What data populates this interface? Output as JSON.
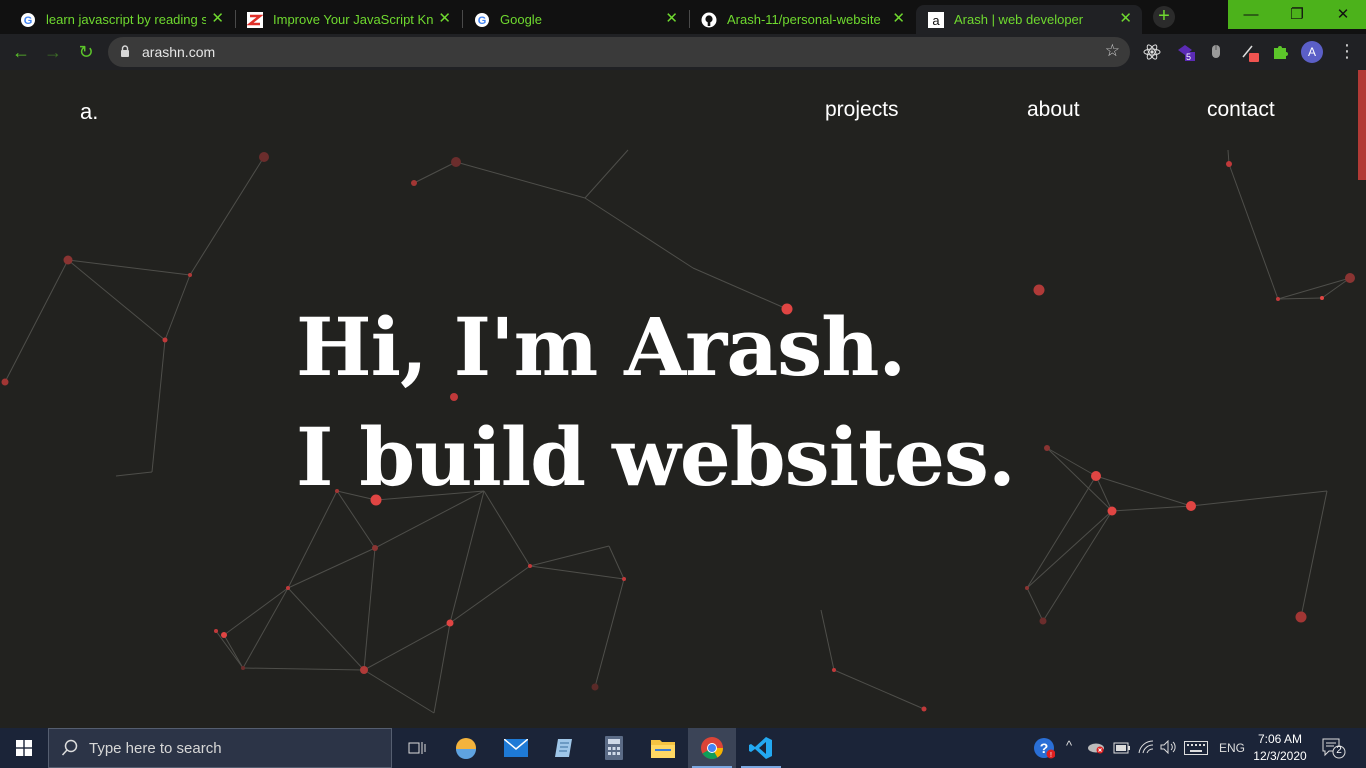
{
  "browser": {
    "tabs": [
      {
        "title": "learn javascript by reading sou",
        "icon": "google-icon"
      },
      {
        "title": "Improve Your JavaScript Knowl",
        "icon": "s-logo-icon"
      },
      {
        "title": "Google",
        "icon": "google-icon"
      },
      {
        "title": "Arash-11/personal-website",
        "icon": "github-icon"
      },
      {
        "title": "Arash | web developer",
        "icon": "a-logo-icon",
        "active": true
      }
    ],
    "close_glyph": "✕",
    "new_tab_glyph": "+",
    "window_controls": {
      "minimize": "—",
      "maximize": "❐",
      "close": "✕"
    },
    "url": "arashn.com",
    "profile_initial": "A",
    "extension_badge": "5",
    "accent_color": "#6fd92f"
  },
  "site": {
    "logo": "a.",
    "nav": [
      "projects",
      "about",
      "contact"
    ],
    "hero_line1": "Hi, I'm Arash.",
    "hero_line2": "I build websites.",
    "node_color": "#c0393a"
  },
  "taskbar": {
    "search_placeholder": "Type here to search",
    "apps": [
      "task-view-icon",
      "weather-icon",
      "mail-icon",
      "notes-icon",
      "calculator-icon",
      "file-explorer-icon",
      "chrome-icon",
      "vscode-icon"
    ],
    "language": "ENG",
    "time": "7:06 AM",
    "date": "12/3/2020",
    "notification_count": "2"
  }
}
